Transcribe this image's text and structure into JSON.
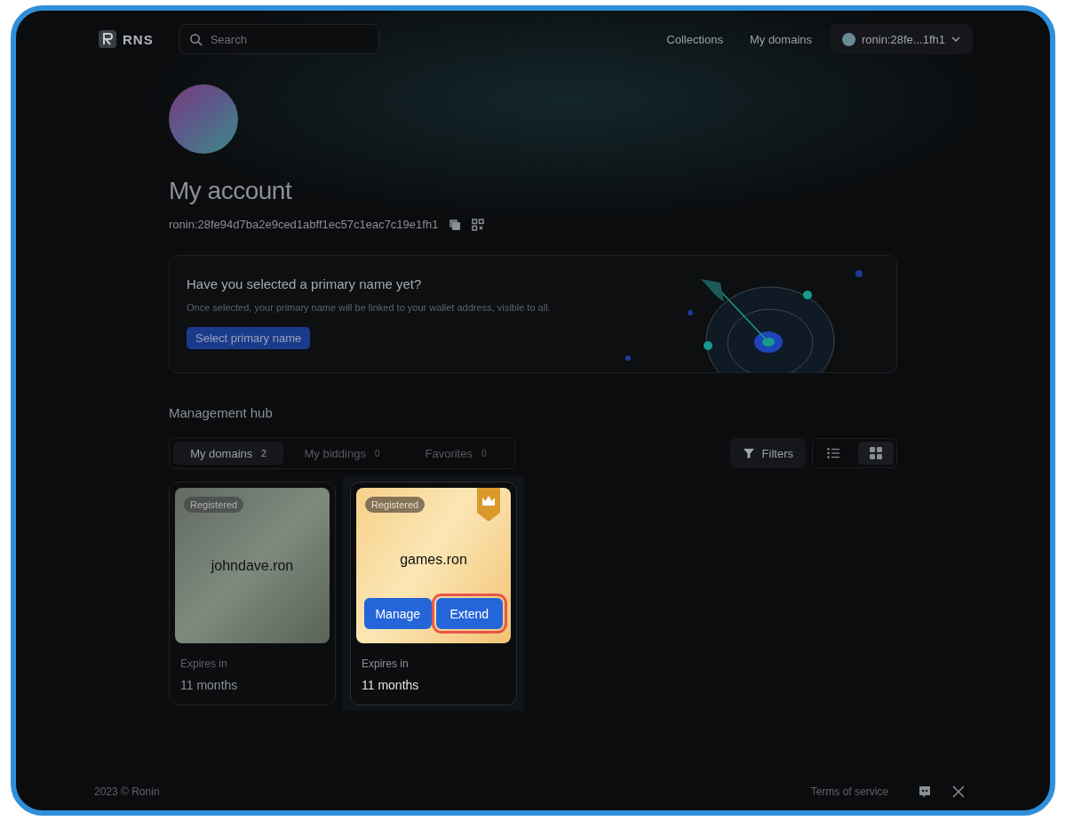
{
  "header": {
    "logo": "RNS",
    "search": {
      "placeholder": "Search"
    },
    "nav": [
      "Collections",
      "My domains"
    ],
    "account": "ronin:28fe...1fh1"
  },
  "profile": {
    "title": "My account",
    "address": "ronin:28fe94d7ba2e9ced1abff1ec57c1eac7c19e1fh1"
  },
  "banner": {
    "title": "Have you selected a primary name yet?",
    "text": "Once selected, your primary name will be linked to your wallet address, visible to all.",
    "button": "Select primary name"
  },
  "hub": {
    "title": "Management hub",
    "tabs": [
      {
        "label": "My domains",
        "count": "2",
        "selected": true
      },
      {
        "label": "My biddings",
        "count": "0",
        "selected": false
      },
      {
        "label": "Favorites",
        "count": "0",
        "selected": false
      }
    ],
    "filters": "Filters",
    "views": [
      {
        "kind": "list",
        "selected": false
      },
      {
        "kind": "grid",
        "selected": true
      }
    ],
    "cards": [
      {
        "status": "Registered",
        "name": "johndave.ron",
        "premium": false,
        "hovered": false,
        "expires_label": "Expires in",
        "expires": "11 months"
      },
      {
        "status": "Registered",
        "name": "games.ron",
        "premium": true,
        "hovered": true,
        "expires_label": "Expires in",
        "expires": "11 months",
        "buttons": [
          {
            "label": "Manage",
            "outlined": false
          },
          {
            "label": "Extend",
            "outlined": true
          }
        ]
      }
    ]
  },
  "footer": {
    "copyright": "2023 © Ronin",
    "links": [
      "Terms of service"
    ]
  }
}
